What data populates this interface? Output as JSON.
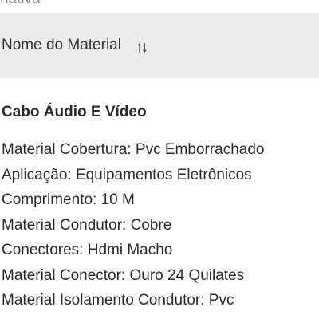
{
  "cut_label": "nativa",
  "sort_header": {
    "label": "Nome do Material",
    "icon": "sort-arrows-icon",
    "icon_glyph": "↑↓"
  },
  "product": {
    "title": "Cabo Áudio E Vídeo",
    "specs": [
      "Material Cobertura: Pvc Emborrachado",
      "Aplicação: Equipamentos Eletrônicos",
      "Comprimento: 10 M",
      "Material Condutor: Cobre",
      "Conectores: Hdmi Macho",
      "Material Conector: Ouro 24 Quilates",
      "Material Isolamento Condutor: Pvc"
    ]
  },
  "colors": {
    "header_background": "#ececec",
    "text": "#2b2b2b",
    "muted_text": "#8a8a8a"
  }
}
